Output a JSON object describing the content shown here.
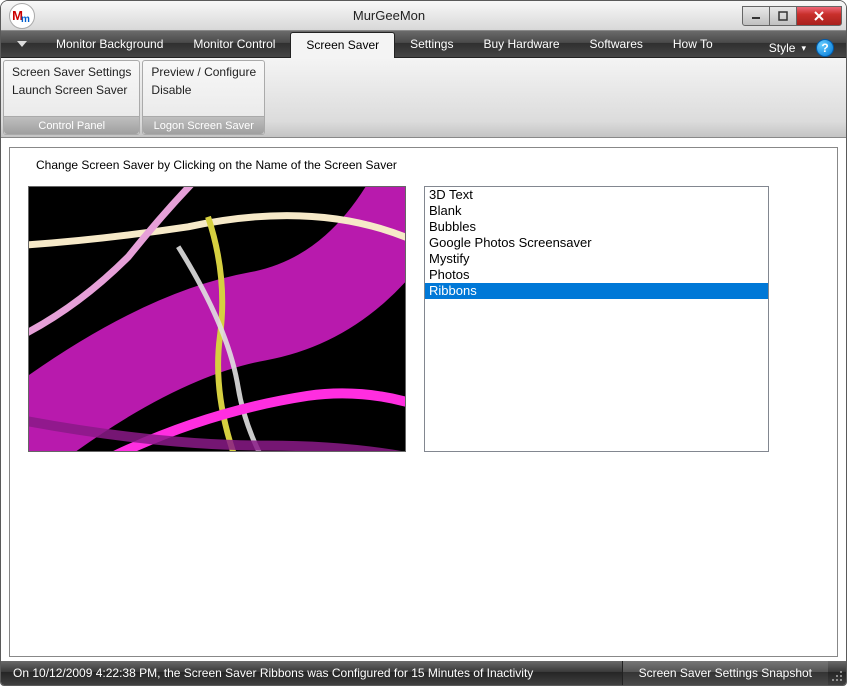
{
  "title": "MurGeeMon",
  "menu": {
    "items": [
      "Monitor Background",
      "Monitor Control",
      "Screen Saver",
      "Settings",
      "Buy Hardware",
      "Softwares",
      "How To"
    ],
    "active_index": 2,
    "style_label": "Style"
  },
  "ribbon": {
    "groups": [
      {
        "label": "Control Panel",
        "items": [
          "Screen Saver Settings",
          "Launch Screen Saver"
        ]
      },
      {
        "label": "Logon Screen Saver",
        "items": [
          "Preview / Configure",
          "Disable"
        ]
      }
    ]
  },
  "content": {
    "instruction": "Change Screen Saver by Clicking on the Name of the Screen Saver",
    "savers": [
      "3D Text",
      "Blank",
      "Bubbles",
      "Google Photos Screensaver",
      "Mystify",
      "Photos",
      "Ribbons"
    ],
    "selected_index": 6
  },
  "status": {
    "message": "On 10/12/2009 4:22:38 PM, the Screen Saver Ribbons was Configured for 15 Minutes of Inactivity",
    "snapshot_label": "Screen Saver Settings Snapshot"
  }
}
